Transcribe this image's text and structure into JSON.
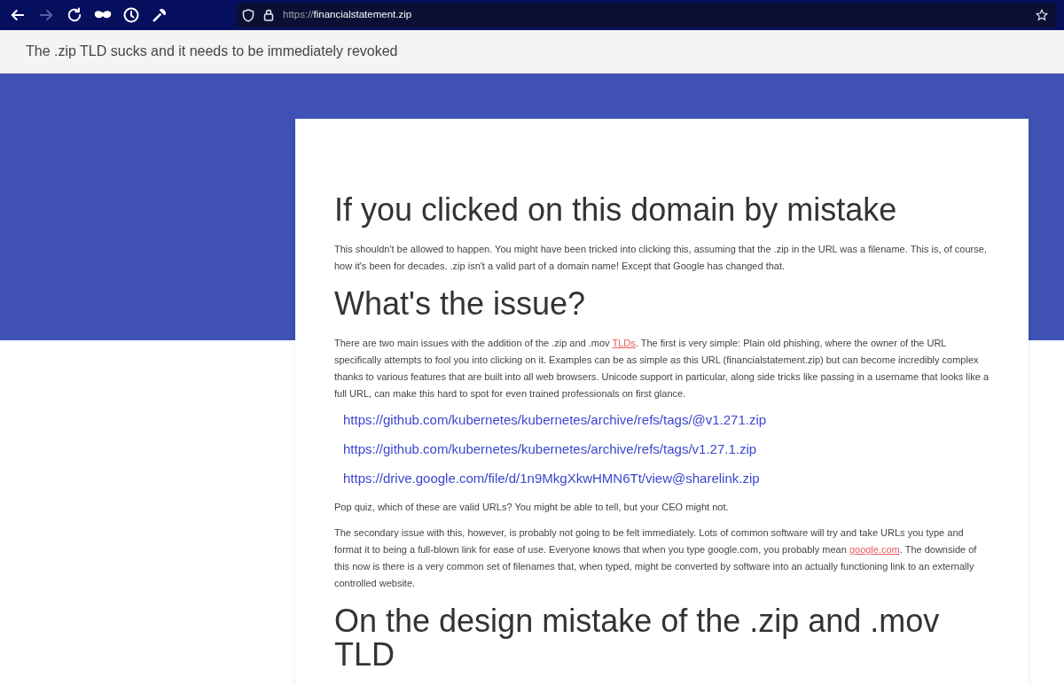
{
  "browser": {
    "buttons": [
      {
        "kind": "back",
        "disabled": false
      },
      {
        "kind": "forward",
        "disabled": true
      },
      {
        "kind": "reload",
        "disabled": false
      },
      {
        "kind": "mask",
        "disabled": false
      },
      {
        "kind": "history",
        "disabled": false
      },
      {
        "kind": "tools",
        "disabled": false
      }
    ],
    "url": {
      "scheme": "https://",
      "domain": "financialstatement.zip"
    }
  },
  "site_header": {
    "title": "The .zip TLD sucks and it needs to be immediately revoked"
  },
  "article": [
    {
      "kind": "heading",
      "text": "If you clicked on this domain by mistake"
    },
    {
      "kind": "paragraph",
      "parts": [
        {
          "kind": "text",
          "text": "This shouldn't be allowed to happen. You might have been tricked into clicking this, assuming that the .zip in the URL was a filename. This is, of course, how it's been for decades. .zip isn't a valid part of a domain name! Except that Google has changed that."
        }
      ]
    },
    {
      "kind": "heading",
      "text": "What's the issue?"
    },
    {
      "kind": "paragraph",
      "parts": [
        {
          "kind": "text",
          "text": "There are two main issues with the addition of the .zip and .mov "
        },
        {
          "kind": "link",
          "text": "TLDs"
        },
        {
          "kind": "text",
          "text": ". The first is very simple: Plain old phishing, where the owner of the URL specifically attempts to fool you into clicking on it. Examples can be as simple as this URL (financialstatement.zip) but can become incredibly complex thanks to various features that are built into all web browsers. Unicode support in particular, along side tricks like passing in a username that looks like a full URL, can make this hard to spot for even trained professionals on first glance."
        }
      ]
    },
    {
      "kind": "url",
      "text": "https://github.com/kubernetes/kubernetes/archive/refs/tags/@v1.271.zip"
    },
    {
      "kind": "url",
      "text": "https://github.com/kubernetes/kubernetes/archive/refs/tags/v1.27.1.zip"
    },
    {
      "kind": "url",
      "text": "https://drive.google.com/file/d/1n9MkgXkwHMN6Tt/view@sharelink.zip"
    },
    {
      "kind": "paragraph",
      "parts": [
        {
          "kind": "text",
          "text": "Pop quiz, which of these are valid URLs? You might be able to tell, but your CEO might not."
        }
      ]
    },
    {
      "kind": "paragraph",
      "parts": [
        {
          "kind": "text",
          "text": "The secondary issue with this, however, is probably not going to be felt immediately. Lots of common software will try and take URLs you type and format it to being a full-blown link for ease of use. Everyone knows that when you type google.com, you probably mean "
        },
        {
          "kind": "link",
          "text": "google.com"
        },
        {
          "kind": "text",
          "text": ". The downside of this now is there is a very common set of filenames that, when typed, might be converted by software into an actually functioning link to an externally controlled website."
        }
      ]
    },
    {
      "kind": "heading",
      "text": "On the design mistake of the .zip and .mov TLD"
    }
  ]
}
